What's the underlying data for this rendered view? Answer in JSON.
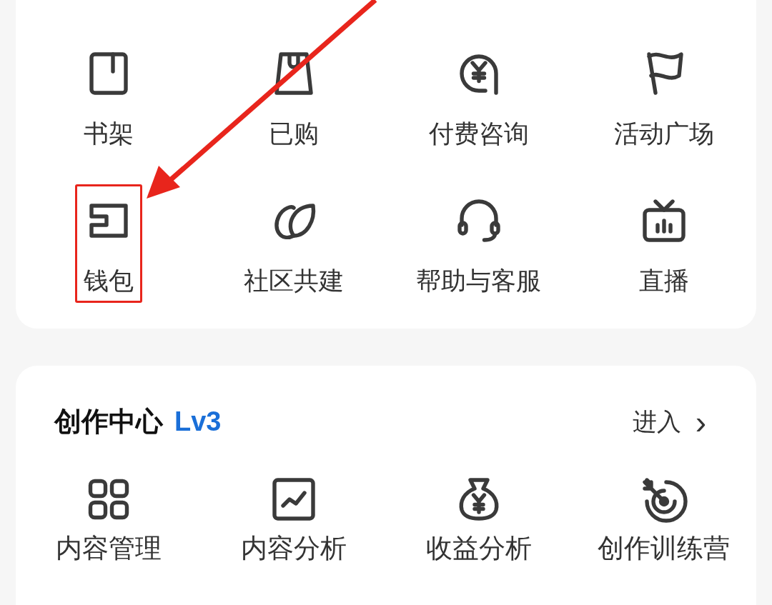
{
  "shortcuts": [
    {
      "label": "书架",
      "highlighted": false
    },
    {
      "label": "已购",
      "highlighted": false
    },
    {
      "label": "付费咨询",
      "highlighted": false
    },
    {
      "label": "活动广场",
      "highlighted": false
    },
    {
      "label": "钱包",
      "highlighted": true
    },
    {
      "label": "社区共建",
      "highlighted": false
    },
    {
      "label": "帮助与客服",
      "highlighted": false
    },
    {
      "label": "直播",
      "highlighted": false
    }
  ],
  "creator_center": {
    "title": "创作中心",
    "level": "Lv3",
    "enter": "进入",
    "chevron": "›",
    "items": [
      {
        "label": "内容管理"
      },
      {
        "label": "内容分析"
      },
      {
        "label": "收益分析"
      },
      {
        "label": "创作训练营"
      }
    ]
  }
}
